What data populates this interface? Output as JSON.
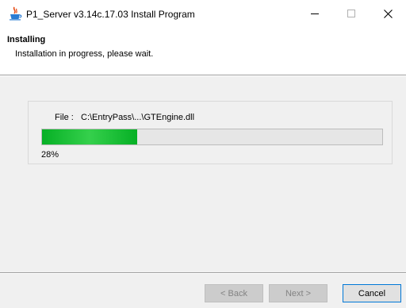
{
  "window": {
    "title": "P1_Server v3.14c.17.03 Install Program",
    "icon": "java-installer-icon",
    "controls": [
      "minimize-icon",
      "maximize-icon",
      "close-icon"
    ]
  },
  "header": {
    "title": "Installing",
    "subtitle": "Installation in progress, please wait."
  },
  "progress": {
    "file_label": "File :",
    "file_path": "C:\\EntryPass\\...\\GTEngine.dll",
    "percent_text": "28%",
    "fraction": 0.28,
    "bar_color": "#06b025",
    "track_color": "#e6e6e6"
  },
  "footer": {
    "back_label": "< Back",
    "next_label": "Next >",
    "cancel_label": "Cancel"
  }
}
